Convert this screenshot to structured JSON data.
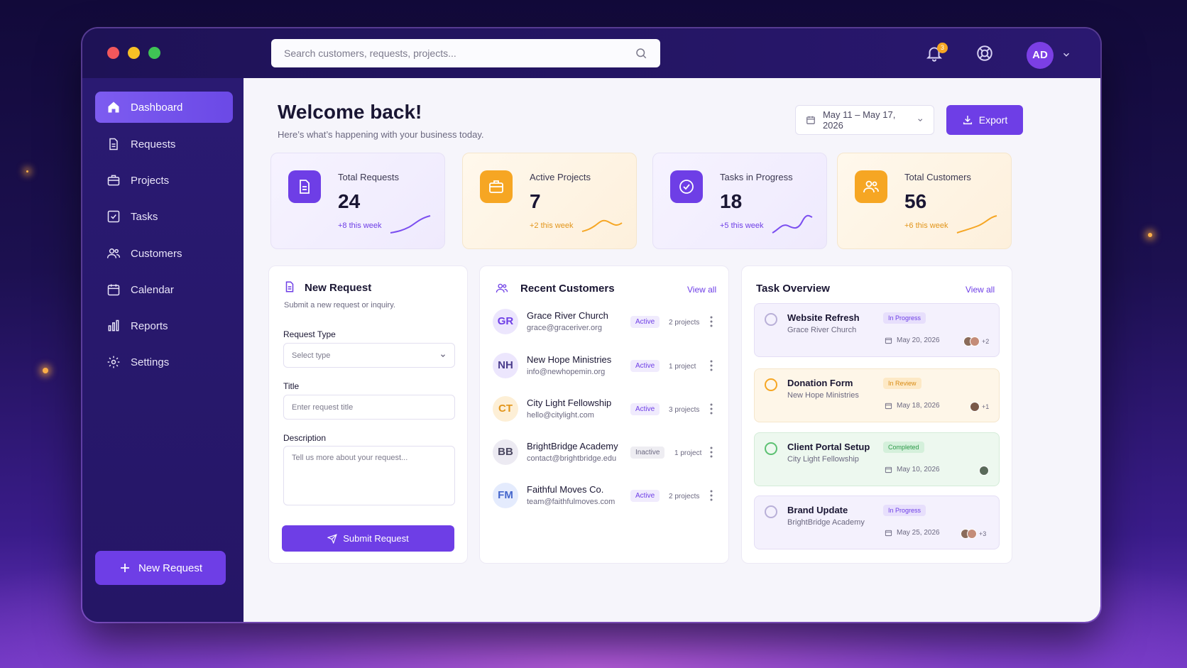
{
  "colors": {
    "accent": "#6e3ee6",
    "orange": "#f6a623",
    "sidebar": "#2a1a72"
  },
  "search": {
    "placeholder": "Search customers, requests, projects..."
  },
  "header": {
    "notification_count": "3",
    "user_initials": "AD"
  },
  "sidebar": {
    "items": [
      {
        "label": "Dashboard",
        "icon": "home-icon"
      },
      {
        "label": "Requests",
        "icon": "document-icon"
      },
      {
        "label": "Projects",
        "icon": "briefcase-icon"
      },
      {
        "label": "Tasks",
        "icon": "checkbox-icon"
      },
      {
        "label": "Customers",
        "icon": "users-icon"
      },
      {
        "label": "Calendar",
        "icon": "calendar-icon"
      },
      {
        "label": "Reports",
        "icon": "bar-chart-icon"
      },
      {
        "label": "Settings",
        "icon": "gear-icon"
      }
    ],
    "new_request": "New Request"
  },
  "main": {
    "title": "Welcome back!",
    "subtitle": "Here’s what’s happening with your business today.",
    "date_range": "May 11 – May 17, 2026",
    "export": "Export"
  },
  "stats": [
    {
      "label": "Total Requests",
      "value": "24",
      "delta": "+8 this week"
    },
    {
      "label": "Active Projects",
      "value": "7",
      "delta": "+2 this week"
    },
    {
      "label": "Tasks in Progress",
      "value": "18",
      "delta": "+5 this week"
    },
    {
      "label": "Total Customers",
      "value": "56",
      "delta": "+6 this week"
    }
  ],
  "new_request_form": {
    "title": "New Request",
    "subtitle": "Submit a new request or inquiry.",
    "type_label": "Request Type",
    "type_placeholder": "Select type",
    "title_label": "Title",
    "title_placeholder": "Enter request title",
    "desc_label": "Description",
    "desc_placeholder": "Tell us more about your request...",
    "submit": "Submit Request"
  },
  "customers": {
    "title": "Recent Customers",
    "view_all": "View all",
    "rows": [
      {
        "initials": "GR",
        "name": "Grace River Church",
        "email": "grace@graceriver.org",
        "status": "Active",
        "projects": "2 projects"
      },
      {
        "initials": "NH",
        "name": "New Hope Ministries",
        "email": "info@newhopemin.org",
        "status": "Active",
        "projects": "1 project"
      },
      {
        "initials": "CT",
        "name": "City Light Fellowship",
        "email": "hello@citylight.com",
        "status": "Active",
        "projects": "3 projects"
      },
      {
        "initials": "BB",
        "name": "BrightBridge Academy",
        "email": "contact@brightbridge.edu",
        "status": "Inactive",
        "projects": "1 project"
      },
      {
        "initials": "FM",
        "name": "Faithful Moves Co.",
        "email": "team@faithfulmoves.com",
        "status": "Active",
        "projects": "2 projects"
      }
    ]
  },
  "tasks": {
    "title": "Task Overview",
    "view_all": "View all",
    "items": [
      {
        "title": "Website Refresh",
        "customer": "Grace River Church",
        "status": "In Progress",
        "date": "May 20, 2026",
        "extra": "+2"
      },
      {
        "title": "Donation Form",
        "customer": "New Hope Ministries",
        "status": "In Review",
        "date": "May 18, 2026",
        "extra": "+1"
      },
      {
        "title": "Client Portal Setup",
        "customer": "City Light Fellowship",
        "status": "Completed",
        "date": "May 10, 2026",
        "extra": ""
      },
      {
        "title": "Brand Update",
        "customer": "BrightBridge Academy",
        "status": "In Progress",
        "date": "May 25, 2026",
        "extra": "+3"
      }
    ]
  }
}
